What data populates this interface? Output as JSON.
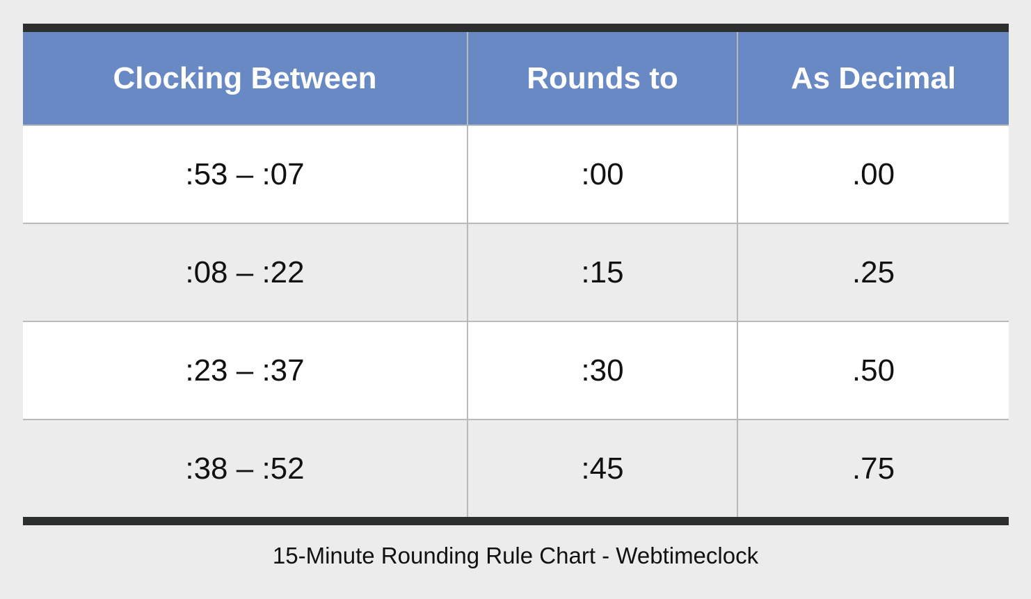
{
  "table": {
    "headers": [
      "Clocking Between",
      "Rounds to",
      "As Decimal"
    ],
    "rows": [
      [
        ":53 – :07",
        ":00",
        ".00"
      ],
      [
        ":08 – :22",
        ":15",
        ".25"
      ],
      [
        ":23 – :37",
        ":30",
        ".50"
      ],
      [
        ":38 – :52",
        ":45",
        ".75"
      ]
    ]
  },
  "caption": "15-Minute Rounding Rule Chart - Webtimeclock",
  "colors": {
    "header_bg": "#6989c5",
    "rule": "#2d2f2e",
    "background": "#ebeceb",
    "grid": "#b9b9b9"
  }
}
